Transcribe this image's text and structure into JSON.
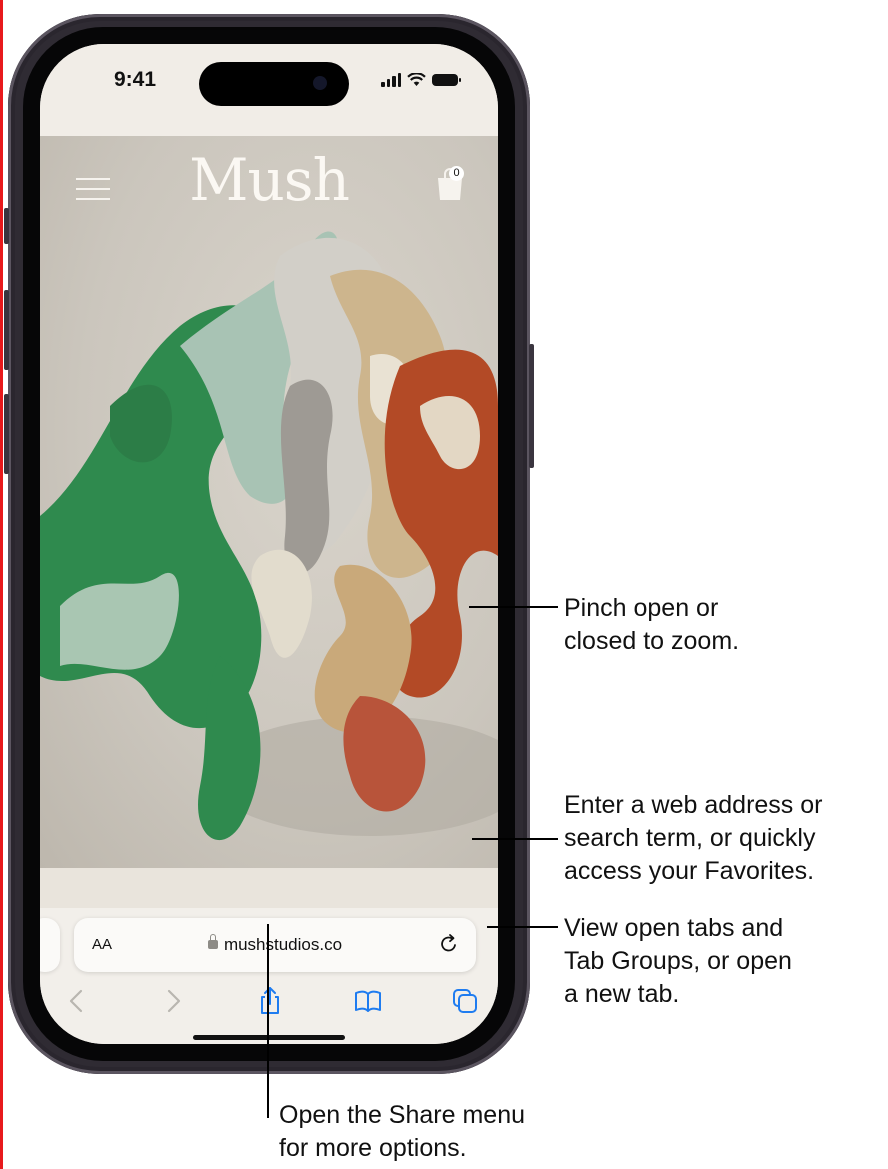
{
  "status_bar": {
    "time": "9:41"
  },
  "website": {
    "logo": "Mush",
    "cart_count": "0"
  },
  "address_bar": {
    "text_size_label": "AA",
    "url": "mushstudios.co"
  },
  "callouts": {
    "zoom": [
      "Pinch open or",
      "closed to zoom."
    ],
    "address": [
      "Enter a web address or",
      "search term, or quickly",
      "access your Favorites."
    ],
    "tabs": [
      "View open tabs and",
      "Tab Groups, or open",
      "a new tab."
    ],
    "share": [
      "Open the Share menu",
      "for more options."
    ]
  },
  "colors": {
    "accent": "#1f7cf0",
    "frame": "#2f2b33",
    "callout_line": "#000000"
  },
  "icons": [
    "menu-icon",
    "bag-icon",
    "lock-icon",
    "reload-icon",
    "back-icon",
    "forward-icon",
    "share-icon",
    "bookmarks-icon",
    "tabs-icon"
  ]
}
